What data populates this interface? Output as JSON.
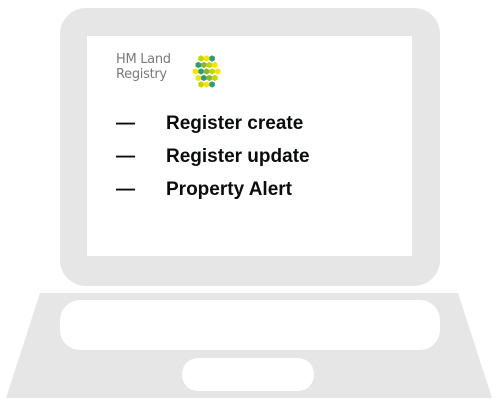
{
  "brand": {
    "line1": "HM Land",
    "line2": "Registry",
    "logo_icon": "hm-land-registry-hexagon-logo",
    "logo_colors": [
      "#c4d600",
      "#8bb830",
      "#2e9e72",
      "#f6e500"
    ]
  },
  "items": [
    {
      "dash": "—",
      "label": "Register create"
    },
    {
      "dash": "—",
      "label": "Register update"
    },
    {
      "dash": "—",
      "label": "Property Alert"
    }
  ],
  "colors": {
    "laptop_body": "#e6e6e6",
    "screen": "#ffffff",
    "text": "#0b0c0c",
    "brand_text": "#7a7a7a"
  }
}
